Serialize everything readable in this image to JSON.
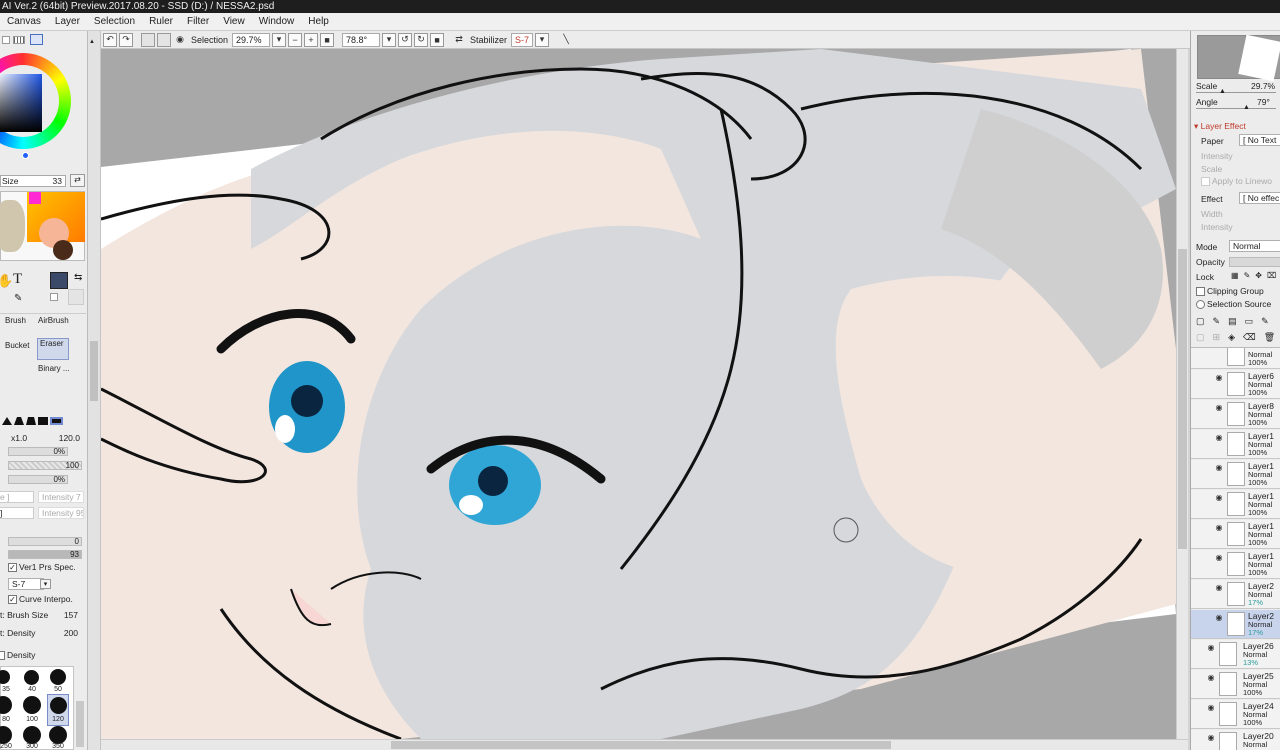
{
  "window": {
    "title": "AI Ver.2 (64bit) Preview.2017.08.20 - SSD (D:) / NESSA2.psd"
  },
  "menu": [
    "Canvas",
    "Layer",
    "Selection",
    "Ruler",
    "Filter",
    "View",
    "Window",
    "Help"
  ],
  "toolbar": {
    "selection_label": "Selection",
    "zoom": "29.7%",
    "angle": "78.8°",
    "stabilizer_label": "Stabilizer",
    "stabilizer_value": "S-7"
  },
  "left_panel": {
    "size_label": "Size",
    "size_value": "33",
    "tools": {
      "brush": "Brush",
      "airbrush": "AirBrush",
      "bucket": "Bucket",
      "eraser": "Eraser",
      "binary": "Binary ..."
    },
    "size_multiplier": "x1.0",
    "size_max": "120.0",
    "min_size": "0%",
    "density": "100",
    "min_density": "0%",
    "intensity_1": "Intensity 7",
    "intensity_2": "Intensity 95",
    "blend_value": "0",
    "persistence": "93",
    "prs_spec_label": "Ver1 Prs Spec.",
    "stab_value": "S-7",
    "curve_interp_label": "Curve Interpo.",
    "max_brush_size_label": "t: Brush Size",
    "max_brush_size": "157",
    "max_density_label": "t: Density",
    "max_density": "200",
    "density_section_label": "Density",
    "brush_sizes": [
      "35",
      "40",
      "50",
      "80",
      "100",
      "120",
      "250",
      "300",
      "350"
    ],
    "brush_shapes_label": "brush tips"
  },
  "right_panel": {
    "scale_label": "Scale",
    "scale_value": "29.7%",
    "angle_label": "Angle",
    "angle_value": "79°",
    "layer_effect_title": "Layer Effect",
    "paper_label": "Paper",
    "paper_value": "[ No Text",
    "intensity_label": "Intensity",
    "scale2_label": "Scale",
    "apply_lineart_label": "Apply to Linewo",
    "effect_label": "Effect",
    "effect_value": "[ No effec",
    "width_label": "Width",
    "intensity2_label": "Intensity",
    "mode_label": "Mode",
    "mode_value": "Normal",
    "opacity_label": "Opacity",
    "lock_label": "Lock",
    "clipping_group_label": "Clipping Group",
    "selection_source_label": "Selection Source"
  },
  "layers": [
    {
      "name": "",
      "mode": "Normal",
      "opacity": "100%",
      "opacity_teal": false,
      "visible": false,
      "selected": false
    },
    {
      "name": "Layer6",
      "mode": "Normal",
      "opacity": "100%",
      "opacity_teal": false,
      "visible": true,
      "selected": false
    },
    {
      "name": "Layer8",
      "mode": "Normal",
      "opacity": "100%",
      "opacity_teal": false,
      "visible": true,
      "selected": false
    },
    {
      "name": "Layer1",
      "mode": "Normal",
      "opacity": "100%",
      "opacity_teal": false,
      "visible": true,
      "selected": false
    },
    {
      "name": "Layer1",
      "mode": "Normal",
      "opacity": "100%",
      "opacity_teal": false,
      "visible": true,
      "selected": false
    },
    {
      "name": "Layer1",
      "mode": "Normal",
      "opacity": "100%",
      "opacity_teal": false,
      "visible": true,
      "selected": false
    },
    {
      "name": "Layer1",
      "mode": "Normal",
      "opacity": "100%",
      "opacity_teal": false,
      "visible": true,
      "selected": false
    },
    {
      "name": "Layer1",
      "mode": "Normal",
      "opacity": "100%",
      "opacity_teal": false,
      "visible": true,
      "selected": false
    },
    {
      "name": "Layer2",
      "mode": "Normal",
      "opacity": "17%",
      "opacity_teal": true,
      "visible": true,
      "selected": false
    },
    {
      "name": "Layer2",
      "mode": "Normal",
      "opacity": "17%",
      "opacity_teal": true,
      "visible": true,
      "selected": true
    },
    {
      "name": "Layer26",
      "mode": "Normal",
      "opacity": "13%",
      "opacity_teal": true,
      "visible": true,
      "selected": false
    },
    {
      "name": "Layer25",
      "mode": "Normal",
      "opacity": "100%",
      "opacity_teal": false,
      "visible": true,
      "selected": false
    },
    {
      "name": "Layer24",
      "mode": "Normal",
      "opacity": "100%",
      "opacity_teal": false,
      "visible": true,
      "selected": false
    },
    {
      "name": "Layer20",
      "mode": "Normal",
      "opacity": "100%",
      "opacity_teal": false,
      "visible": true,
      "selected": false
    }
  ],
  "colors": {
    "primary": "#3a4a68",
    "skin": "#f3e6df",
    "hair": "#d6d8dc",
    "eye": "#4fc3e8",
    "lineart": "#111111",
    "selected_layer": "#c8d4ec"
  }
}
